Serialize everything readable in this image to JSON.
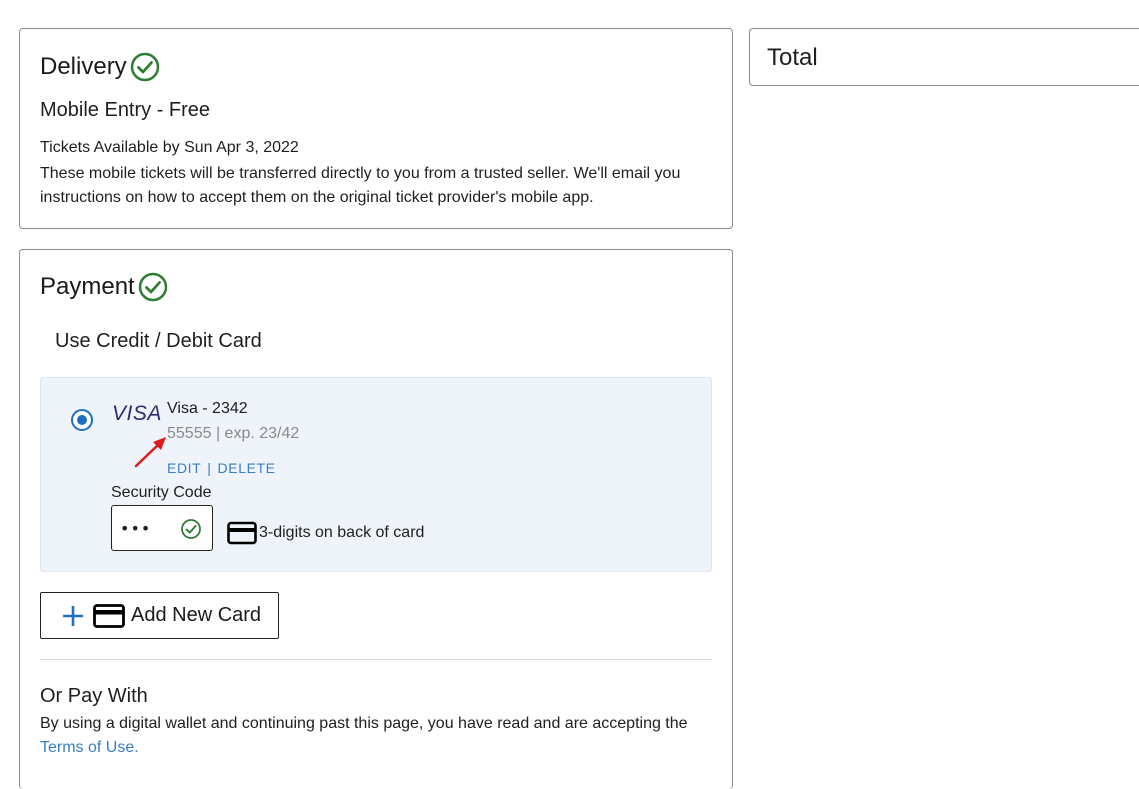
{
  "colors": {
    "accent_blue": "#1f6fc7",
    "link_blue": "#3b7ec6",
    "success_green": "#2e7d32",
    "panel_bg": "#eef4f9",
    "annotation_red": "#e0191b"
  },
  "icons": {
    "delivery_check": "check-circle-icon",
    "payment_check": "check-circle-icon",
    "security_check": "check-circle-icon",
    "credit_card": "credit-card-icon",
    "plus": "plus-icon"
  },
  "delivery": {
    "title": "Delivery",
    "method": "Mobile Entry - Free",
    "available_date": "Tickets Available by Sun Apr 3, 2022",
    "description": "These mobile tickets will be transferred directly to you from a trusted seller. We'll email you instructions on how to accept them on the original ticket provider's mobile app."
  },
  "total": {
    "title": "Total"
  },
  "payment": {
    "title": "Payment",
    "method_label": "Use Credit / Debit Card",
    "saved_card": {
      "brand_logo": "VISA",
      "name": "Visa - 2342",
      "details": "55555 | exp. 23/42",
      "edit_label": "EDIT",
      "separator": "|",
      "delete_label": "DELETE",
      "security_label": "Security Code",
      "security_value": "•••",
      "cvv_hint": "3-digits on back of card"
    },
    "add_card_label": "Add New Card",
    "or_pay_with": "Or Pay With",
    "wallet_notice": "By using a digital wallet and continuing past this page, you have read and are accepting the ",
    "terms_link": "Terms of Use."
  }
}
